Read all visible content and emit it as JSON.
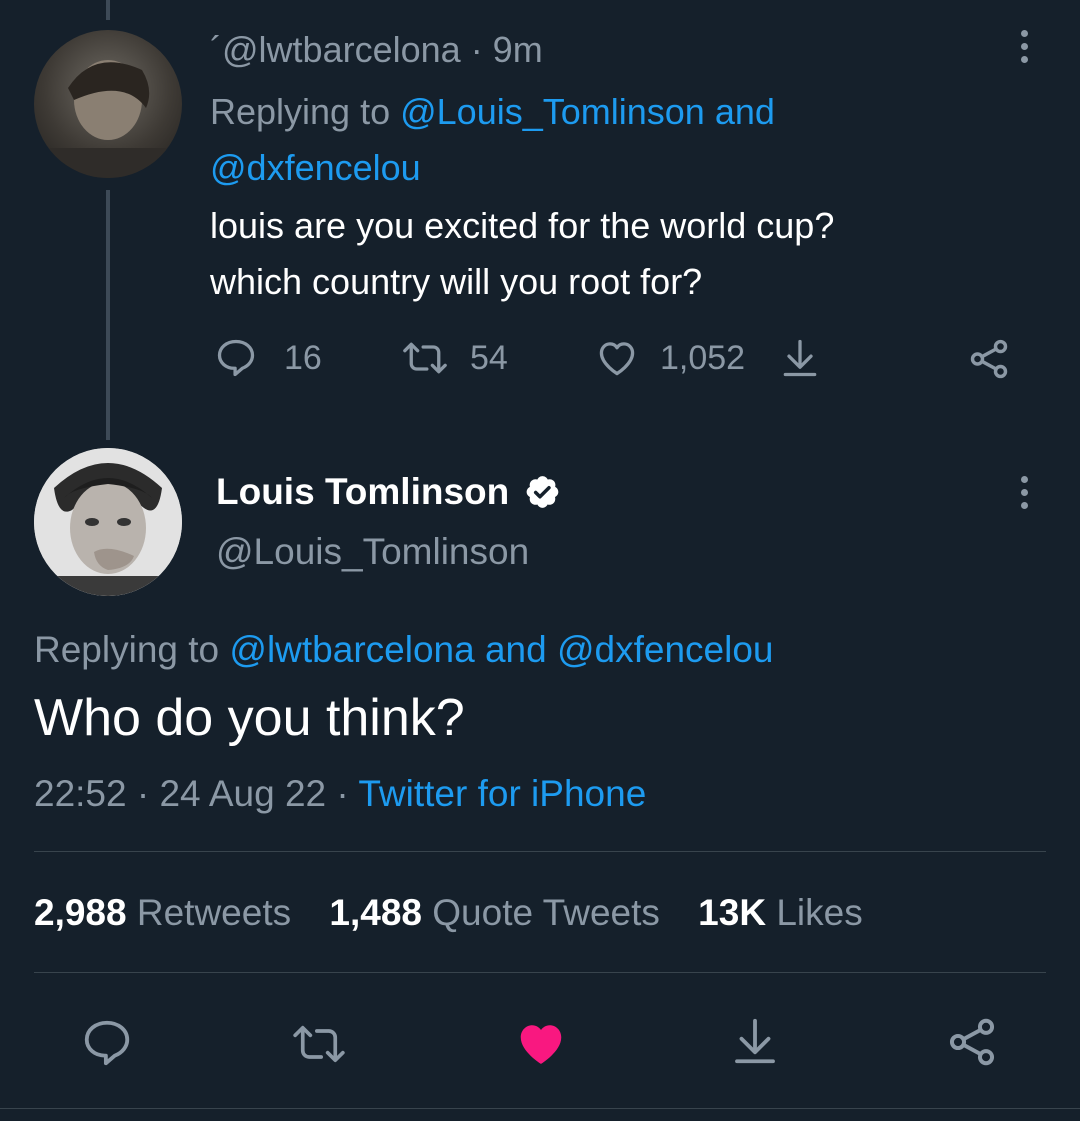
{
  "reply_tweet": {
    "handle_prefix": "´",
    "handle": "@lwtbarcelona",
    "time": "· 9m",
    "replying_label": "Replying to ",
    "replying_to_1": "@Louis_Tomlinson",
    "replying_and": " and",
    "replying_to_2": "@dxfencelou",
    "text_line1": "louis are you excited for the world cup?",
    "text_line2": "which country will you root for?",
    "replies": "16",
    "retweets": "54",
    "likes": "1,052"
  },
  "main_tweet": {
    "display_name": "Louis Tomlinson",
    "handle": "@Louis_Tomlinson",
    "replying_label": "Replying to ",
    "replying_to_1": "@lwtbarcelona",
    "replying_and": " and ",
    "replying_to_2": "@dxfencelou",
    "text": "Who do you think?",
    "time": "22:52 · 24 Aug 22 · ",
    "source": "Twitter for iPhone",
    "retweets_count": "2,988",
    "retweets_label": " Retweets",
    "quotes_count": "1,488",
    "quotes_label": " Quote Tweets",
    "likes_count": "13K",
    "likes_label": " Likes"
  },
  "colors": {
    "background": "#15202b",
    "accent": "#1d9bf0",
    "muted": "#8b98a5",
    "like_active": "#f91880"
  },
  "icons": [
    "reply-icon",
    "retweet-icon",
    "like-icon",
    "bookmark-icon",
    "share-icon",
    "verified-badge-icon",
    "more-options-icon"
  ]
}
